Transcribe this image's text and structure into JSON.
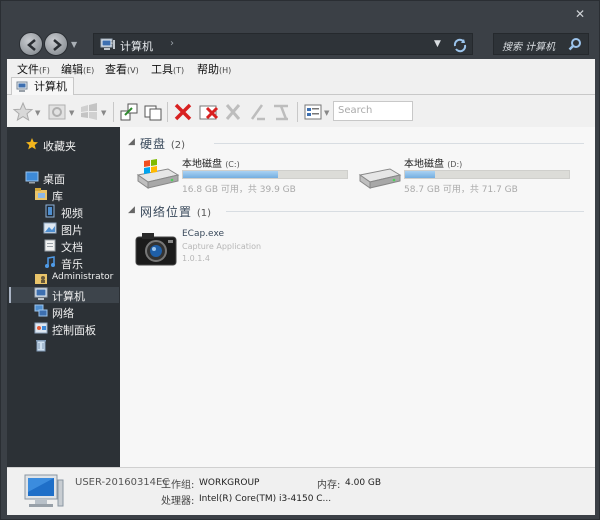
{
  "window": {
    "close_glyph": "✕"
  },
  "address": {
    "crumb": "计算机",
    "search_placeholder": "搜索 计算机"
  },
  "menu": [
    {
      "label": "文件",
      "key": "(F)"
    },
    {
      "label": "编辑",
      "key": "(E)"
    },
    {
      "label": "查看",
      "key": "(V)"
    },
    {
      "label": "工具",
      "key": "(T)"
    },
    {
      "label": "帮助",
      "key": "(H)"
    }
  ],
  "tab": {
    "label": "计算机"
  },
  "toolbar": {
    "search_placeholder": "Search"
  },
  "sidebar": {
    "favorites": "收藏夹",
    "desktop": "桌面",
    "library": "库",
    "videos": "视频",
    "pictures": "图片",
    "documents": "文档",
    "music": "音乐",
    "administrator": "Administrator",
    "computer": "计算机",
    "network": "网络",
    "control_panel": "控制面板"
  },
  "content": {
    "disks_group": {
      "title": "硬盘",
      "count": "(2)"
    },
    "drives": [
      {
        "name": "本地磁盘",
        "letter": "(C:)",
        "free": "16.8 GB 可用，共 39.9 GB",
        "used_fraction": 0.58
      },
      {
        "name": "本地磁盘",
        "letter": "(D:)",
        "free": "58.7 GB 可用，共 71.7 GB",
        "used_fraction": 0.18
      }
    ],
    "network_group": {
      "title": "网络位置",
      "count": "(1)"
    },
    "app": {
      "name": "ECap.exe",
      "desc": "Capture Application",
      "version": "1.0.1.4"
    }
  },
  "details": {
    "computer_name": "USER-20160314EC",
    "workgroup_label": "工作组:",
    "workgroup": "WORKGROUP",
    "memory_label": "内存:",
    "memory": "4.00 GB",
    "processor_label": "处理器:",
    "processor": "Intel(R) Core(TM) i3-4150 C..."
  },
  "colors": {
    "frame": "#3b4046",
    "sidebar": "#2c3136",
    "content": "#f7f7f7",
    "bar_fill": "#74aee0"
  }
}
